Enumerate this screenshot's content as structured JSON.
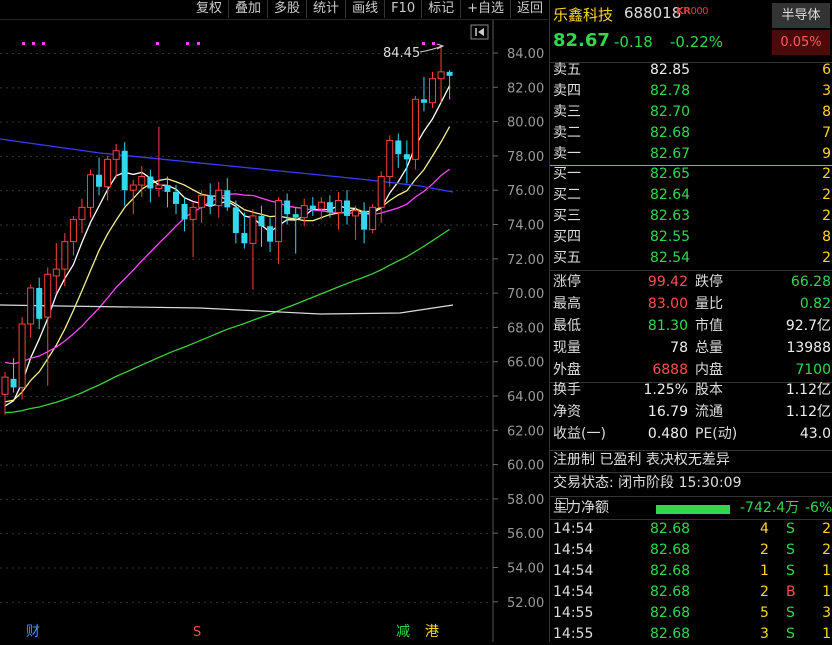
{
  "toolbar": [
    "复权",
    "叠加",
    "多股",
    "统计",
    "画线",
    "F10",
    "标记",
    "+自选",
    "返回"
  ],
  "chart": {
    "y_labels": [
      "84.00",
      "82.00",
      "80.00",
      "78.00",
      "76.00",
      "74.00",
      "72.00",
      "70.00",
      "68.00",
      "66.00",
      "64.00",
      "62.00",
      "60.00",
      "58.00",
      "56.00",
      "54.00",
      "52.00"
    ],
    "peak_label": "84.45",
    "markers": [
      "财",
      "S",
      "减",
      "港"
    ],
    "candles": [
      [
        64.1,
        65.4,
        62.9,
        65.1
      ],
      [
        65.0,
        66.2,
        64.2,
        64.5
      ],
      [
        64.5,
        68.6,
        63.8,
        68.2
      ],
      [
        68.2,
        70.5,
        67.4,
        70.3
      ],
      [
        70.3,
        70.9,
        67.9,
        68.5
      ],
      [
        68.6,
        71.5,
        64.6,
        71.1
      ],
      [
        71.0,
        72.9,
        70.0,
        71.4
      ],
      [
        71.4,
        73.5,
        70.4,
        73.0
      ],
      [
        73.0,
        74.5,
        72.2,
        74.3
      ],
      [
        74.3,
        75.5,
        73.5,
        75.0
      ],
      [
        75.0,
        77.2,
        74.4,
        76.9
      ],
      [
        76.9,
        77.9,
        75.7,
        76.2
      ],
      [
        76.2,
        78.0,
        75.4,
        77.8
      ],
      [
        77.8,
        78.7,
        76.7,
        78.3
      ],
      [
        78.3,
        78.8,
        75.1,
        76.0
      ],
      [
        76.0,
        76.6,
        74.6,
        76.3
      ],
      [
        76.3,
        77.4,
        75.6,
        76.8
      ],
      [
        76.8,
        77.2,
        75.3,
        76.1
      ],
      [
        76.1,
        79.7,
        75.6,
        76.3
      ],
      [
        76.3,
        76.8,
        75.0,
        75.9
      ],
      [
        75.9,
        76.3,
        74.6,
        75.2
      ],
      [
        75.2,
        75.6,
        73.6,
        74.3
      ],
      [
        74.3,
        75.3,
        72.1,
        75.0
      ],
      [
        75.0,
        76.0,
        74.1,
        75.7
      ],
      [
        75.7,
        76.4,
        74.6,
        75.1
      ],
      [
        75.1,
        76.5,
        74.4,
        76.0
      ],
      [
        76.0,
        76.7,
        74.8,
        75.0
      ],
      [
        75.0,
        75.4,
        72.9,
        73.5
      ],
      [
        73.5,
        74.7,
        72.6,
        72.9
      ],
      [
        72.9,
        74.9,
        70.2,
        74.5
      ],
      [
        74.5,
        75.1,
        72.7,
        73.9
      ],
      [
        73.9,
        74.4,
        72.4,
        73.0
      ],
      [
        73.0,
        75.6,
        71.7,
        75.4
      ],
      [
        75.4,
        75.8,
        74.0,
        74.6
      ],
      [
        74.6,
        75.0,
        72.3,
        74.4
      ],
      [
        74.4,
        75.5,
        73.9,
        75.1
      ],
      [
        75.1,
        75.6,
        74.5,
        74.9
      ],
      [
        74.9,
        75.6,
        74.3,
        75.3
      ],
      [
        75.3,
        75.7,
        74.4,
        74.7
      ],
      [
        74.7,
        75.9,
        73.7,
        75.4
      ],
      [
        75.4,
        76.0,
        74.0,
        74.5
      ],
      [
        74.5,
        75.1,
        73.1,
        74.8
      ],
      [
        74.8,
        75.3,
        72.9,
        73.7
      ],
      [
        73.7,
        75.2,
        73.5,
        75.0
      ],
      [
        75.0,
        77.1,
        74.1,
        76.8
      ],
      [
        76.8,
        79.2,
        76.2,
        78.9
      ],
      [
        78.9,
        79.3,
        77.3,
        78.1
      ],
      [
        78.1,
        78.9,
        76.4,
        77.8
      ],
      [
        77.8,
        81.5,
        77.2,
        81.3
      ],
      [
        81.3,
        82.6,
        80.6,
        81.1
      ],
      [
        81.1,
        82.9,
        80.8,
        82.5
      ],
      [
        82.5,
        84.45,
        81.1,
        82.9
      ],
      [
        82.9,
        83.0,
        81.3,
        82.67
      ]
    ]
  },
  "header": {
    "name": "乐鑫科技",
    "code": "688018",
    "tag": "KR",
    "tag2": "000",
    "half_btn": "半导体",
    "pct_box": "0.05%",
    "price": "82.67",
    "change": "-0.18",
    "change_pct": "-0.22%"
  },
  "sell": [
    {
      "label": "卖五",
      "price": "82.85",
      "vol": "6"
    },
    {
      "label": "卖四",
      "price": "82.78",
      "vol": "3"
    },
    {
      "label": "卖三",
      "price": "82.70",
      "vol": "8"
    },
    {
      "label": "卖二",
      "price": "82.68",
      "vol": "7"
    },
    {
      "label": "卖一",
      "price": "82.67",
      "vol": "9"
    }
  ],
  "buy": [
    {
      "label": "买一",
      "price": "82.65",
      "vol": "2"
    },
    {
      "label": "买二",
      "price": "82.64",
      "vol": "2"
    },
    {
      "label": "买三",
      "price": "82.63",
      "vol": "2"
    },
    {
      "label": "买四",
      "price": "82.55",
      "vol": "8"
    },
    {
      "label": "买五",
      "price": "82.54",
      "vol": "2"
    }
  ],
  "stats": [
    {
      "l1": "涨停",
      "v1": "99.42",
      "l2": "跌停",
      "v2": "66.28"
    },
    {
      "l1": "最高",
      "v1": "83.00",
      "l2": "量比",
      "v2": "0.82"
    },
    {
      "l1": "最低",
      "v1": "81.30",
      "l2": "市值",
      "v2": "92.7亿"
    },
    {
      "l1": "现量",
      "v1": "78",
      "l2": "总量",
      "v2": "13988"
    },
    {
      "l1": "外盘",
      "v1": "6888",
      "l2": "内盘",
      "v2": "7100"
    }
  ],
  "stats2": [
    {
      "l1": "换手",
      "v1": "1.25%",
      "l2": "股本",
      "v2": "1.12亿"
    },
    {
      "l1": "净资",
      "v1": "16.79",
      "l2": "流通",
      "v2": "1.12亿"
    },
    {
      "l1": "收益(一)",
      "v1": "0.480",
      "l2": "PE(动)",
      "v2": "43.0"
    }
  ],
  "info_line": "注册制 已盈利 表决权无差异",
  "trade_status": "交易状态: 闭市阶段 15:30:09",
  "main_flow": {
    "label": "主力净额",
    "value": "-742.4万",
    "pct": "-6%"
  },
  "ticks": [
    {
      "time": "14:54",
      "price": "82.68",
      "vol": "4",
      "side": "S",
      "n": "2"
    },
    {
      "time": "14:54",
      "price": "82.68",
      "vol": "2",
      "side": "S",
      "n": "2"
    },
    {
      "time": "14:54",
      "price": "82.68",
      "vol": "1",
      "side": "S",
      "n": "1"
    },
    {
      "time": "14:54",
      "price": "82.68",
      "vol": "2",
      "side": "B",
      "n": "1"
    },
    {
      "time": "14:55",
      "price": "82.68",
      "vol": "5",
      "side": "S",
      "n": "3"
    },
    {
      "time": "14:55",
      "price": "82.68",
      "vol": "3",
      "side": "S",
      "n": "1"
    }
  ]
}
